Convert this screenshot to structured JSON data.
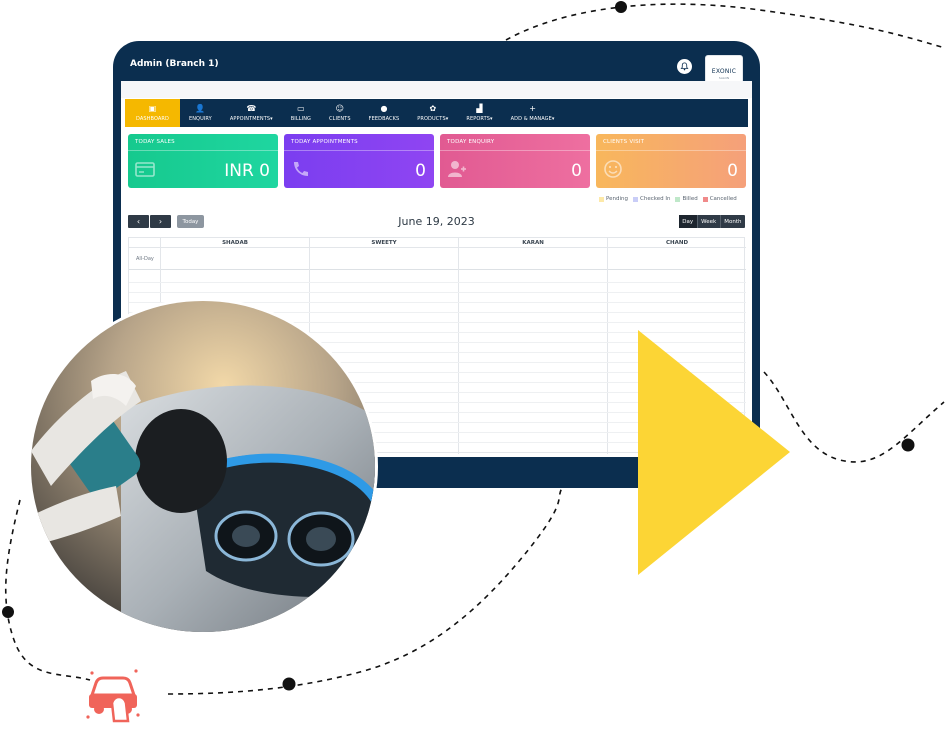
{
  "header": {
    "title": "Admin (Branch 1)",
    "logo_text": "EXONIC",
    "logo_sub": "SALON"
  },
  "nav": {
    "items": [
      {
        "label": "DASHBOARD",
        "icon": "dashboard-icon"
      },
      {
        "label": "ENQUIRY",
        "icon": "add-user-icon"
      },
      {
        "label": "APPOINTMENTS",
        "icon": "phone-icon",
        "dropdown": true
      },
      {
        "label": "BILLING",
        "icon": "billing-icon"
      },
      {
        "label": "CLIENTS",
        "icon": "smiley-icon"
      },
      {
        "label": "FEEDBACKS",
        "icon": "feedback-icon"
      },
      {
        "label": "PRODUCTS",
        "icon": "products-icon",
        "dropdown": true
      },
      {
        "label": "REPORTS",
        "icon": "reports-icon",
        "dropdown": true
      },
      {
        "label": "ADD & MANAGE",
        "icon": "plus-icon",
        "dropdown": true
      }
    ],
    "dropdown_caret": "▾"
  },
  "cards": [
    {
      "title": "TODAY SALES",
      "value": "INR 0",
      "icon": "card-icon"
    },
    {
      "title": "TODAY APPOINTMENTS",
      "value": "0",
      "icon": "phone-icon"
    },
    {
      "title": "TODAY ENQUIRY",
      "value": "0",
      "icon": "add-user-icon"
    },
    {
      "title": "CLIENTS VISIT",
      "value": "0",
      "icon": "smiley-icon"
    }
  ],
  "legend": [
    {
      "label": "Pending",
      "color": "#fde9a8"
    },
    {
      "label": "Checked In",
      "color": "#c9cdf7"
    },
    {
      "label": "Billed",
      "color": "#bfe8c9"
    },
    {
      "label": "Cancelled",
      "color": "#f08a8a"
    }
  ],
  "calendar": {
    "prev": "‹",
    "next": "›",
    "today_label": "Today",
    "date": "June 19, 2023",
    "views": [
      "Day",
      "Week",
      "Month"
    ],
    "all_day_label": "All-Day",
    "columns": [
      "SHADAB",
      "SWEETY",
      "KARAN",
      "CHAND"
    ]
  },
  "colors": {
    "navy": "#0b2e4f",
    "active_tab": "#f5b800",
    "accent_yellow": "#fcd535",
    "accent_red": "#f0645a"
  }
}
